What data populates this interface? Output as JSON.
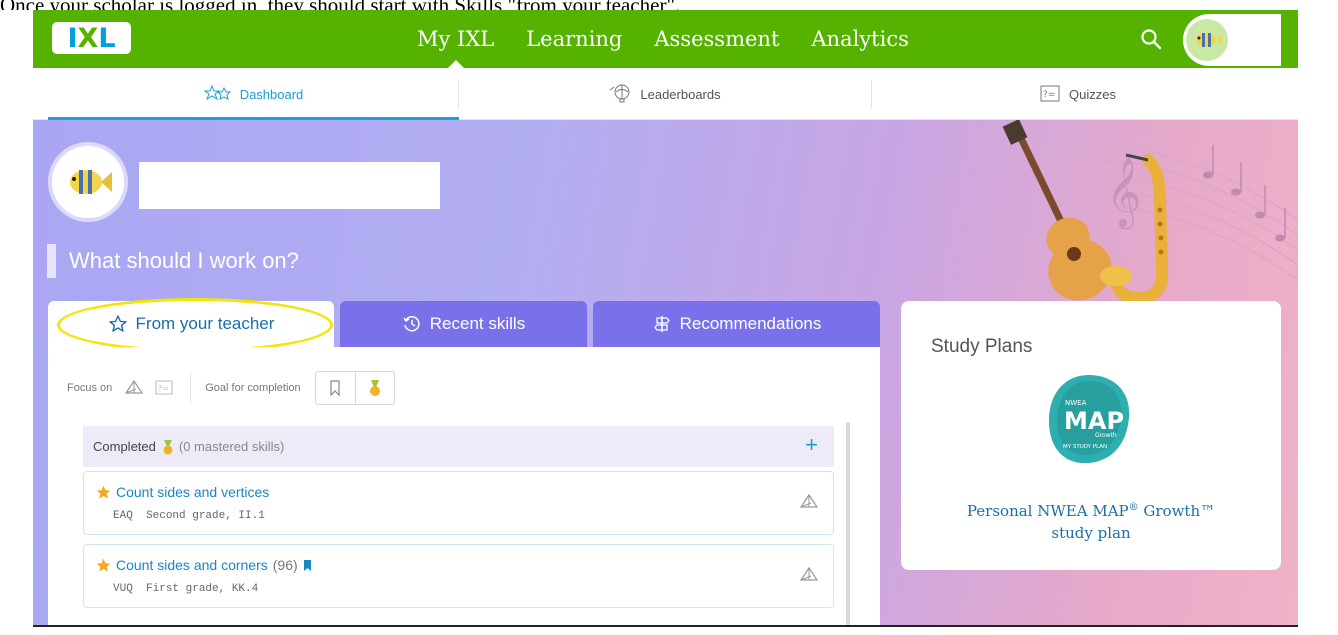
{
  "caption": "Once your scholar is logged in, they should start with Skills \"from your teacher\".",
  "topbar": {
    "logo": "IXL",
    "nav": [
      "My IXL",
      "Learning",
      "Assessment",
      "Analytics"
    ],
    "active_nav": "My IXL"
  },
  "subnav": {
    "tabs": [
      "Dashboard",
      "Leaderboards",
      "Quizzes"
    ],
    "active": "Dashboard"
  },
  "hero": {
    "question": "What should I work on?"
  },
  "tabs": {
    "teacher": "From your teacher",
    "recent": "Recent skills",
    "recommendations": "Recommendations"
  },
  "panel": {
    "focus_label": "Focus on",
    "goal_label": "Goal for completion",
    "completed_label": "Completed",
    "completed_sub": "(0 mastered skills)",
    "skills": [
      {
        "title": "Count sides and vertices",
        "score": "",
        "code": "EAQ",
        "grade": "Second grade, II.1"
      },
      {
        "title": "Count sides and corners",
        "score": "(96)",
        "code": "VUQ",
        "grade": "First grade, KK.4"
      }
    ]
  },
  "study_plans": {
    "title": "Study Plans",
    "badge_top": "NWEA",
    "badge_main": "MAP",
    "badge_growth": "Growth",
    "badge_bottom": "MY STUDY PLAN",
    "link_line1": "Personal NWEA MAP",
    "reg": "®",
    "link_line1b": " Growth™",
    "link_line2": "study plan"
  },
  "colors": {
    "nav_green": "#56b200",
    "tab_purple": "#7970ea",
    "link_blue": "#1a86c2",
    "highlight_yellow": "#f3e40a"
  }
}
